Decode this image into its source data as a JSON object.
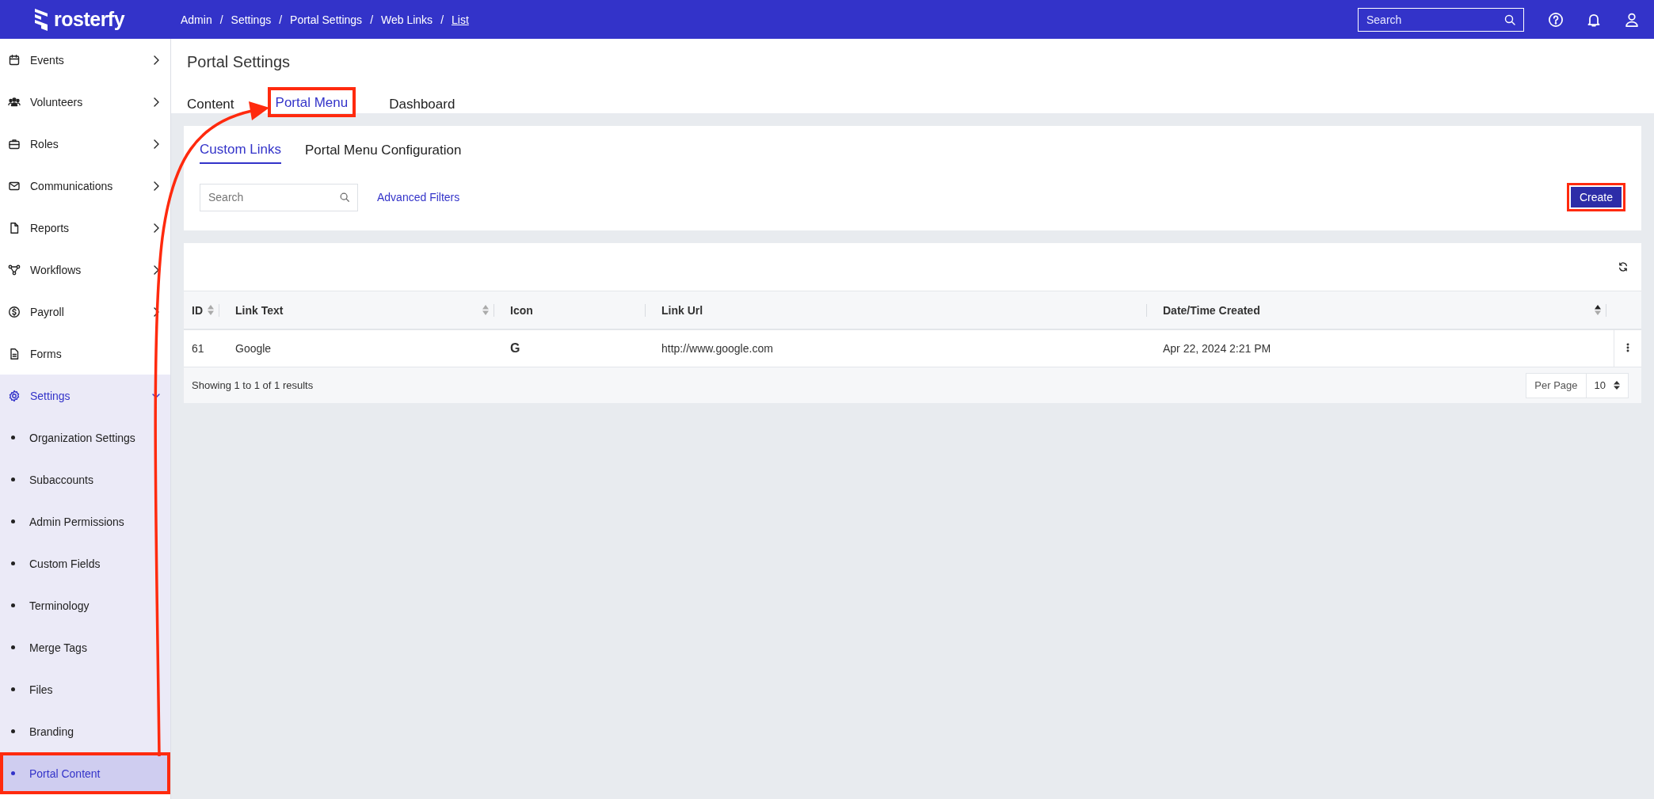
{
  "top_bar": {
    "logo": "rosterfy",
    "breadcrumbs": [
      {
        "label": "Admin",
        "selected": false
      },
      {
        "label": "Settings",
        "selected": false
      },
      {
        "label": "Portal Settings",
        "selected": false
      },
      {
        "label": "Web Links",
        "selected": false
      },
      {
        "label": "List",
        "selected": true
      }
    ],
    "separator": "/",
    "search": {
      "placeholder": "Search"
    }
  },
  "sidebar": {
    "items": [
      {
        "label": "Events",
        "expanded": false,
        "selected": false,
        "annotated": false
      },
      {
        "label": "Volunteers",
        "expanded": false,
        "selected": false,
        "annotated": false
      },
      {
        "label": "Roles",
        "expanded": false,
        "selected": false,
        "annotated": false
      },
      {
        "label": "Communications",
        "expanded": false,
        "selected": false,
        "annotated": false
      },
      {
        "label": "Reports",
        "expanded": false,
        "selected": false,
        "annotated": false
      },
      {
        "label": "Workflows",
        "expanded": false,
        "selected": false,
        "annotated": false
      },
      {
        "label": "Payroll",
        "expanded": false,
        "selected": false,
        "annotated": false
      },
      {
        "label": "Forms",
        "selected": false,
        "annotated": false
      },
      {
        "label": "Settings",
        "expanded": true,
        "selected": true,
        "annotated": false,
        "children": [
          {
            "label": "Organization Settings",
            "selected": false,
            "annotated": false
          },
          {
            "label": "Subaccounts",
            "selected": false,
            "annotated": false
          },
          {
            "label": "Admin Permissions",
            "selected": false,
            "annotated": false
          },
          {
            "label": "Custom Fields",
            "selected": false,
            "annotated": false
          },
          {
            "label": "Terminology",
            "selected": false,
            "annotated": false
          },
          {
            "label": "Merge Tags",
            "selected": false,
            "annotated": false
          },
          {
            "label": "Files",
            "selected": false,
            "annotated": false
          },
          {
            "label": "Branding",
            "selected": false,
            "annotated": false
          },
          {
            "label": "Portal Content",
            "selected": true,
            "annotated": true
          }
        ]
      }
    ]
  },
  "page": {
    "title": "Portal Settings",
    "tabs": [
      {
        "label": "Content",
        "selected": false,
        "annotated": false
      },
      {
        "label": "Portal Menu",
        "selected": true,
        "annotated": true
      },
      {
        "label": "Dashboard",
        "selected": false,
        "annotated": false
      }
    ]
  },
  "panel": {
    "tabs": [
      {
        "label": "Custom Links",
        "selected": true
      },
      {
        "label": "Portal Menu Configuration",
        "selected": false
      }
    ],
    "search": {
      "placeholder": "Search"
    },
    "advanced_filters": "Advanced Filters",
    "create_button": {
      "label": "Create",
      "annotated": true
    }
  },
  "table": {
    "columns": [
      {
        "label": "ID",
        "sortable": true,
        "sorted_ascending": false
      },
      {
        "label": "Link Text",
        "sortable": true,
        "sorted_ascending": false
      },
      {
        "label": "Icon",
        "sortable": false
      },
      {
        "label": "Link Url",
        "sortable": false
      },
      {
        "label": "Date/Time Created",
        "sortable": true,
        "sorted_ascending": true
      }
    ],
    "rows": [
      {
        "id": "61",
        "link_text": "Google",
        "icon": "G",
        "link_url": "http://www.google.com",
        "created": "Apr 22, 2024 2:21 PM"
      }
    ],
    "summary": "Showing 1 to 1 of 1 results",
    "per_page_label": "Per Page",
    "per_page": "10"
  },
  "annotation": {
    "arrow": true
  }
}
